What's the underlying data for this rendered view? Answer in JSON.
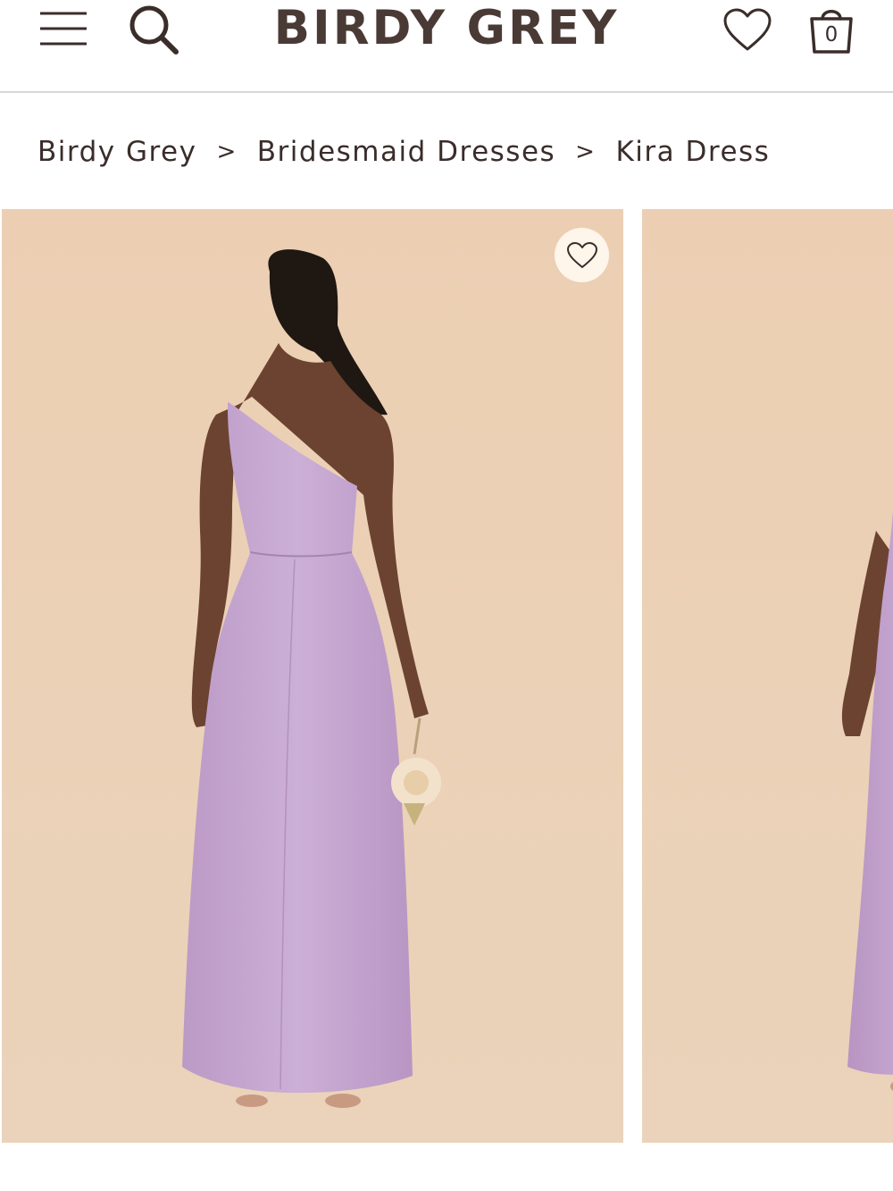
{
  "header": {
    "logo_text": "BIRDY GREY",
    "menu_icon": "hamburger-menu-icon",
    "search_icon": "search-icon",
    "wishlist_icon": "heart-icon",
    "cart_icon": "shopping-bag-icon",
    "cart_count": "0"
  },
  "breadcrumb": {
    "items": [
      "Birdy Grey",
      "Bridesmaid Dresses",
      "Kira Dress"
    ],
    "separator": ">"
  },
  "gallery": {
    "favorite_icon": "heart-outline-icon",
    "background_color": "#ecd4b8",
    "dress_color": "#c9a9d2"
  },
  "colors": {
    "text": "#3a2d2a",
    "logo": "#4a3a36",
    "divider": "#d8d8d8"
  }
}
